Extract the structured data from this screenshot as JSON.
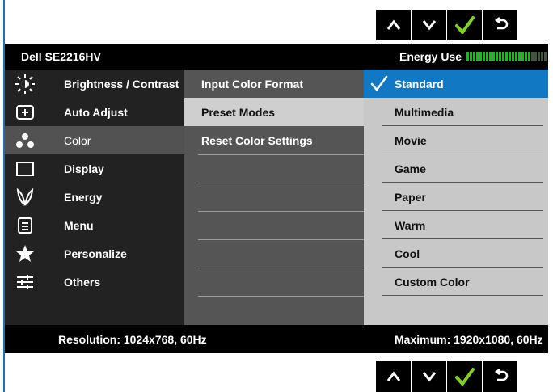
{
  "monitor": {
    "model": "Dell SE2216HV",
    "energy_label": "Energy Use"
  },
  "energy_meter": {
    "level": 0.8,
    "color_on": "#00cc00",
    "color_off": "#3a5a3a"
  },
  "nav_buttons": [
    "up-arrow-icon",
    "down-arrow-icon",
    "check-icon",
    "back-icon"
  ],
  "menu": {
    "items": [
      {
        "label": "Brightness / Contrast",
        "icon": "brightness-icon"
      },
      {
        "label": "Auto Adjust",
        "icon": "auto-adjust-icon"
      },
      {
        "label": "Color",
        "icon": "color-icon",
        "selected": true
      },
      {
        "label": "Display",
        "icon": "display-icon"
      },
      {
        "label": "Energy",
        "icon": "energy-icon"
      },
      {
        "label": "Menu",
        "icon": "menu-icon"
      },
      {
        "label": "Personalize",
        "icon": "star-icon"
      },
      {
        "label": "Others",
        "icon": "others-icon"
      }
    ]
  },
  "submenu": {
    "items": [
      {
        "label": "Input Color Format"
      },
      {
        "label": "Preset Modes",
        "highlighted": true
      },
      {
        "label": "Reset Color Settings"
      }
    ]
  },
  "preset_modes": {
    "options": [
      "Standard",
      "Multimedia",
      "Movie",
      "Game",
      "Paper",
      "Warm",
      "Cool",
      "Custom Color"
    ],
    "selected": "Standard"
  },
  "footer": {
    "resolution": "Resolution: 1024x768, 60Hz",
    "maximum": "Maximum: 1920x1080, 60Hz"
  },
  "colors": {
    "accent": "#1178c3",
    "check": "#7ed321",
    "frame": "#1f6fb5"
  }
}
